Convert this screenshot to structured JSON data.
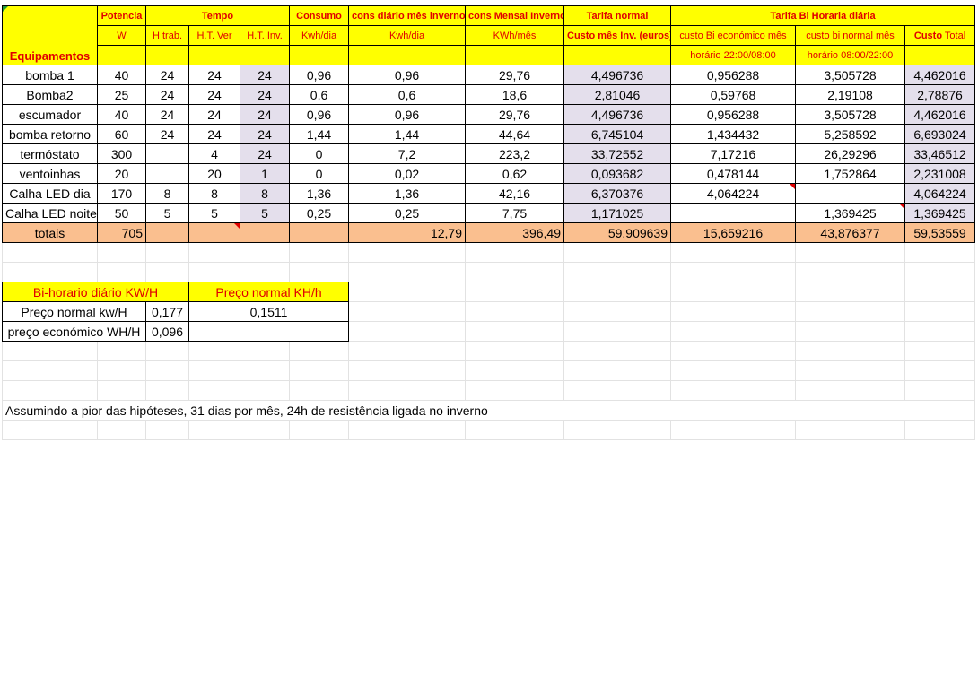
{
  "header": {
    "potencia": "Potencia",
    "tempo": "Tempo",
    "consumo": "Consumo",
    "cons_diario": "cons diário mês inverno",
    "cons_mensal": "cons Mensal Inverno",
    "tarifa_normal": "Tarifa normal",
    "tarifa_bi": "Tarifa Bi Horaria diária",
    "unit_w": "W",
    "h_trab": "H trab.",
    "ht_ver": "H.T. Ver",
    "ht_inv": "H.T. Inv.",
    "kwh_dia1": "Kwh/dia",
    "kwh_dia2": "Kwh/dia",
    "kwh_mes": "KWh/mês",
    "custo_mes_inv": "Custo mês Inv. (euros)",
    "custo_bi_econ": "custo Bi económico mês",
    "custo_bi_normal": "custo bi normal mês",
    "custo_total_a": "Custo",
    "custo_total_b": "Total",
    "equipamentos": "Equipamentos",
    "horario_econ": "horário 22:00/08:00",
    "horario_normal": "horário 08:00/22:00"
  },
  "rows": [
    {
      "name": "bomba 1",
      "w": "40",
      "htrab": "24",
      "htver": "24",
      "htinv": "24",
      "kwhdia": "0,96",
      "consdia": "0,96",
      "consmes": "29,76",
      "custo": "4,496736",
      "econ": "0,956288",
      "normal": "3,505728",
      "total": "4,462016"
    },
    {
      "name": "Bomba2",
      "w": "25",
      "htrab": "24",
      "htver": "24",
      "htinv": "24",
      "kwhdia": "0,6",
      "consdia": "0,6",
      "consmes": "18,6",
      "custo": "2,81046",
      "econ": "0,59768",
      "normal": "2,19108",
      "total": "2,78876"
    },
    {
      "name": "escumador",
      "w": "40",
      "htrab": "24",
      "htver": "24",
      "htinv": "24",
      "kwhdia": "0,96",
      "consdia": "0,96",
      "consmes": "29,76",
      "custo": "4,496736",
      "econ": "0,956288",
      "normal": "3,505728",
      "total": "4,462016"
    },
    {
      "name": "bomba retorno",
      "w": "60",
      "htrab": "24",
      "htver": "24",
      "htinv": "24",
      "kwhdia": "1,44",
      "consdia": "1,44",
      "consmes": "44,64",
      "custo": "6,745104",
      "econ": "1,434432",
      "normal": "5,258592",
      "total": "6,693024"
    },
    {
      "name": "termóstato",
      "w": "300",
      "htrab": "",
      "htver": "4",
      "htinv": "24",
      "kwhdia": "0",
      "consdia": "7,2",
      "consmes": "223,2",
      "custo": "33,72552",
      "econ": "7,17216",
      "normal": "26,29296",
      "total": "33,46512"
    },
    {
      "name": "ventoinhas",
      "w": "20",
      "htrab": "",
      "htver": "20",
      "htinv": "1",
      "kwhdia": "0",
      "consdia": "0,02",
      "consmes": "0,62",
      "custo": "0,093682",
      "econ": "0,478144",
      "normal": "1,752864",
      "total": "2,231008"
    },
    {
      "name": "Calha LED dia",
      "w": "170",
      "htrab": "8",
      "htver": "8",
      "htinv": "8",
      "kwhdia": "1,36",
      "consdia": "1,36",
      "consmes": "42,16",
      "custo": "6,370376",
      "econ": "4,064224",
      "normal": "",
      "total": "4,064224"
    },
    {
      "name": "Calha LED noite",
      "w": "50",
      "htrab": "5",
      "htver": "5",
      "htinv": "5",
      "kwhdia": "0,25",
      "consdia": "0,25",
      "consmes": "7,75",
      "custo": "1,171025",
      "econ": "",
      "normal": "1,369425",
      "total": "1,369425"
    }
  ],
  "totals": {
    "label": "totais",
    "w": "705",
    "consdia": "12,79",
    "consmes": "396,49",
    "custo": "59,909639",
    "econ": "15,659216",
    "normal": "43,876377",
    "total": "59,53559"
  },
  "prices": {
    "title_bi": "Bi-horario diário KW/H",
    "title_normal": "Preço normal KH/h",
    "row1_label": "Preço normal kw/H",
    "row1_value": "0,177",
    "row1_normal": "0,1511",
    "row2_label": "preço económico WH/H",
    "row2_value": "0,096"
  },
  "note": "Assumindo a pior das hipóteses, 31 dias por mês, 24h de resistência ligada no inverno",
  "colors": {
    "yellow": "#ffff00",
    "red": "#e00000",
    "lavender": "#e4dfec",
    "totals": "#fabf8f"
  }
}
